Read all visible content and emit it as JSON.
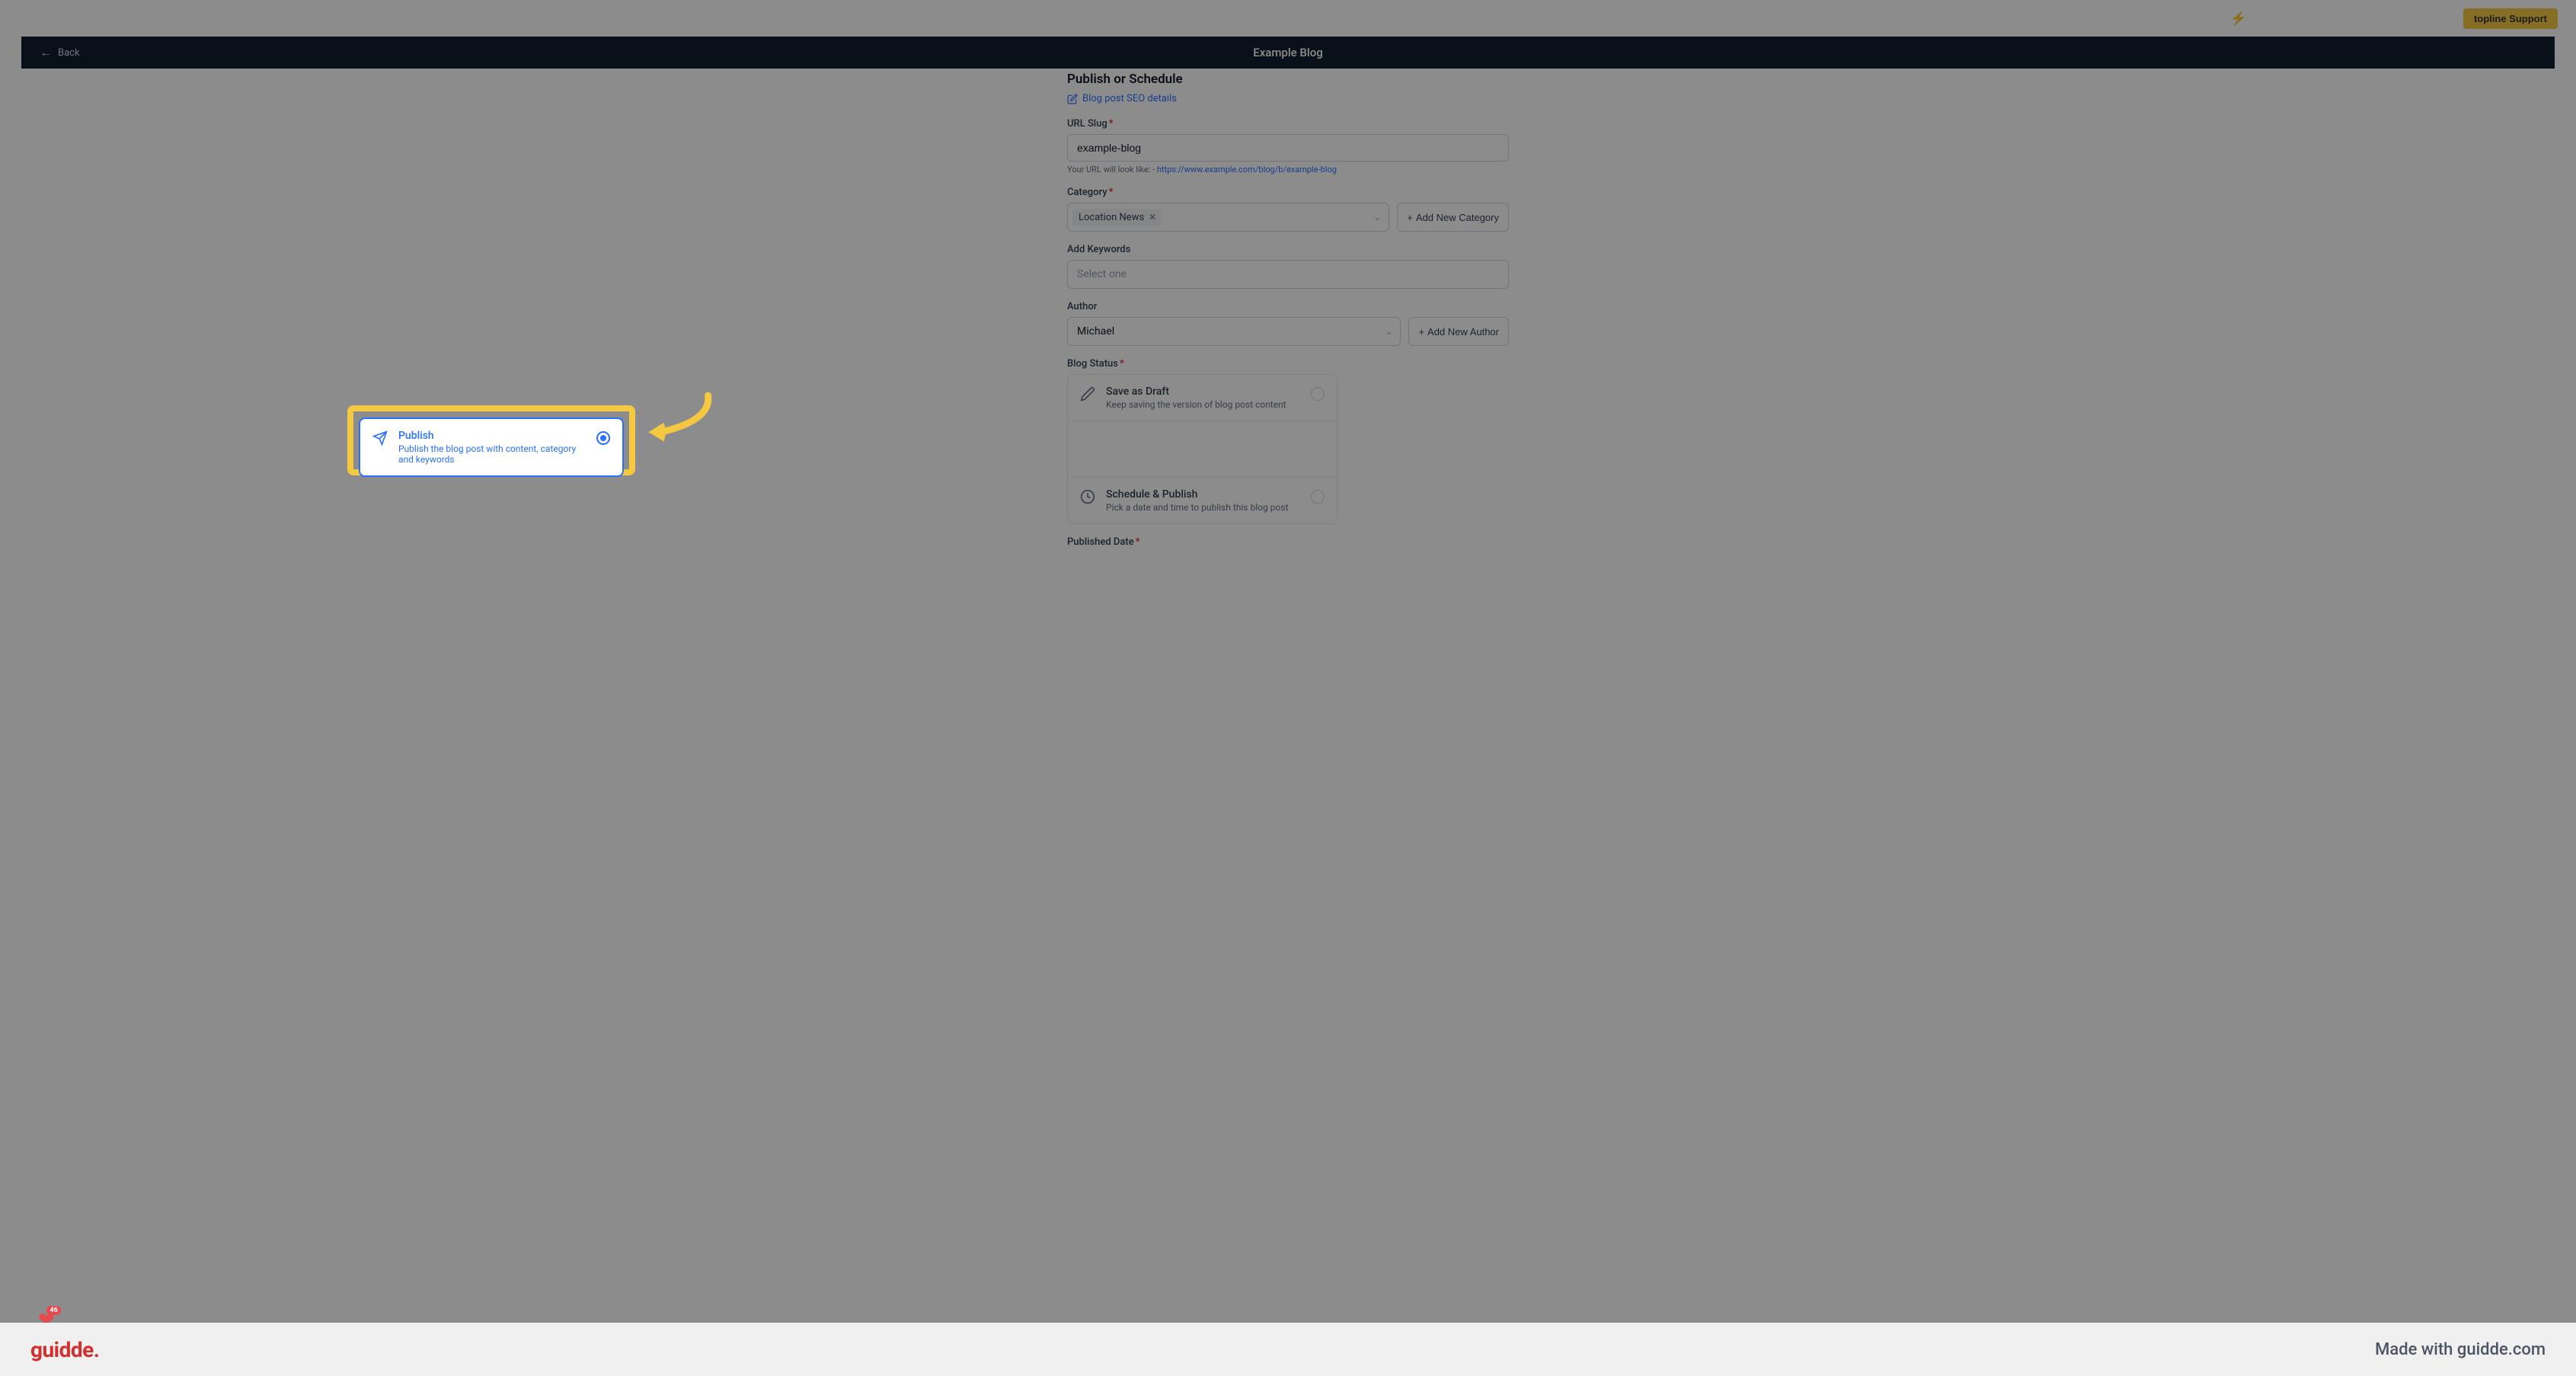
{
  "topbar": {
    "support_label": "topline Support"
  },
  "header": {
    "back_label": "Back",
    "title": "Example Blog"
  },
  "form": {
    "section_title": "Publish or Schedule",
    "seo_link": "Blog post SEO details",
    "url_slug": {
      "label": "URL Slug",
      "value": "example-blog",
      "hint_prefix": "Your URL will look like: - ",
      "hint_url": "https://www.example.com/blog/b/example-blog"
    },
    "category": {
      "label": "Category",
      "selected": "Location News",
      "add_button": "Add New Category"
    },
    "keywords": {
      "label": "Add Keywords",
      "placeholder": "Select one"
    },
    "author": {
      "label": "Author",
      "selected": "Michael",
      "add_button": "Add New Author"
    },
    "status": {
      "label": "Blog Status",
      "options": {
        "draft": {
          "title": "Save as Draft",
          "desc": "Keep saving the version of blog post content"
        },
        "publish": {
          "title": "Publish",
          "desc": "Publish the blog post with content, category and keywords"
        },
        "schedule": {
          "title": "Schedule & Publish",
          "desc": "Pick a date and time to publish this blog post"
        }
      }
    },
    "published_date": {
      "label": "Published Date"
    }
  },
  "heart_badge": {
    "count": "46"
  },
  "footer": {
    "logo": "guidde",
    "made_with": "Made with guidde.com"
  }
}
